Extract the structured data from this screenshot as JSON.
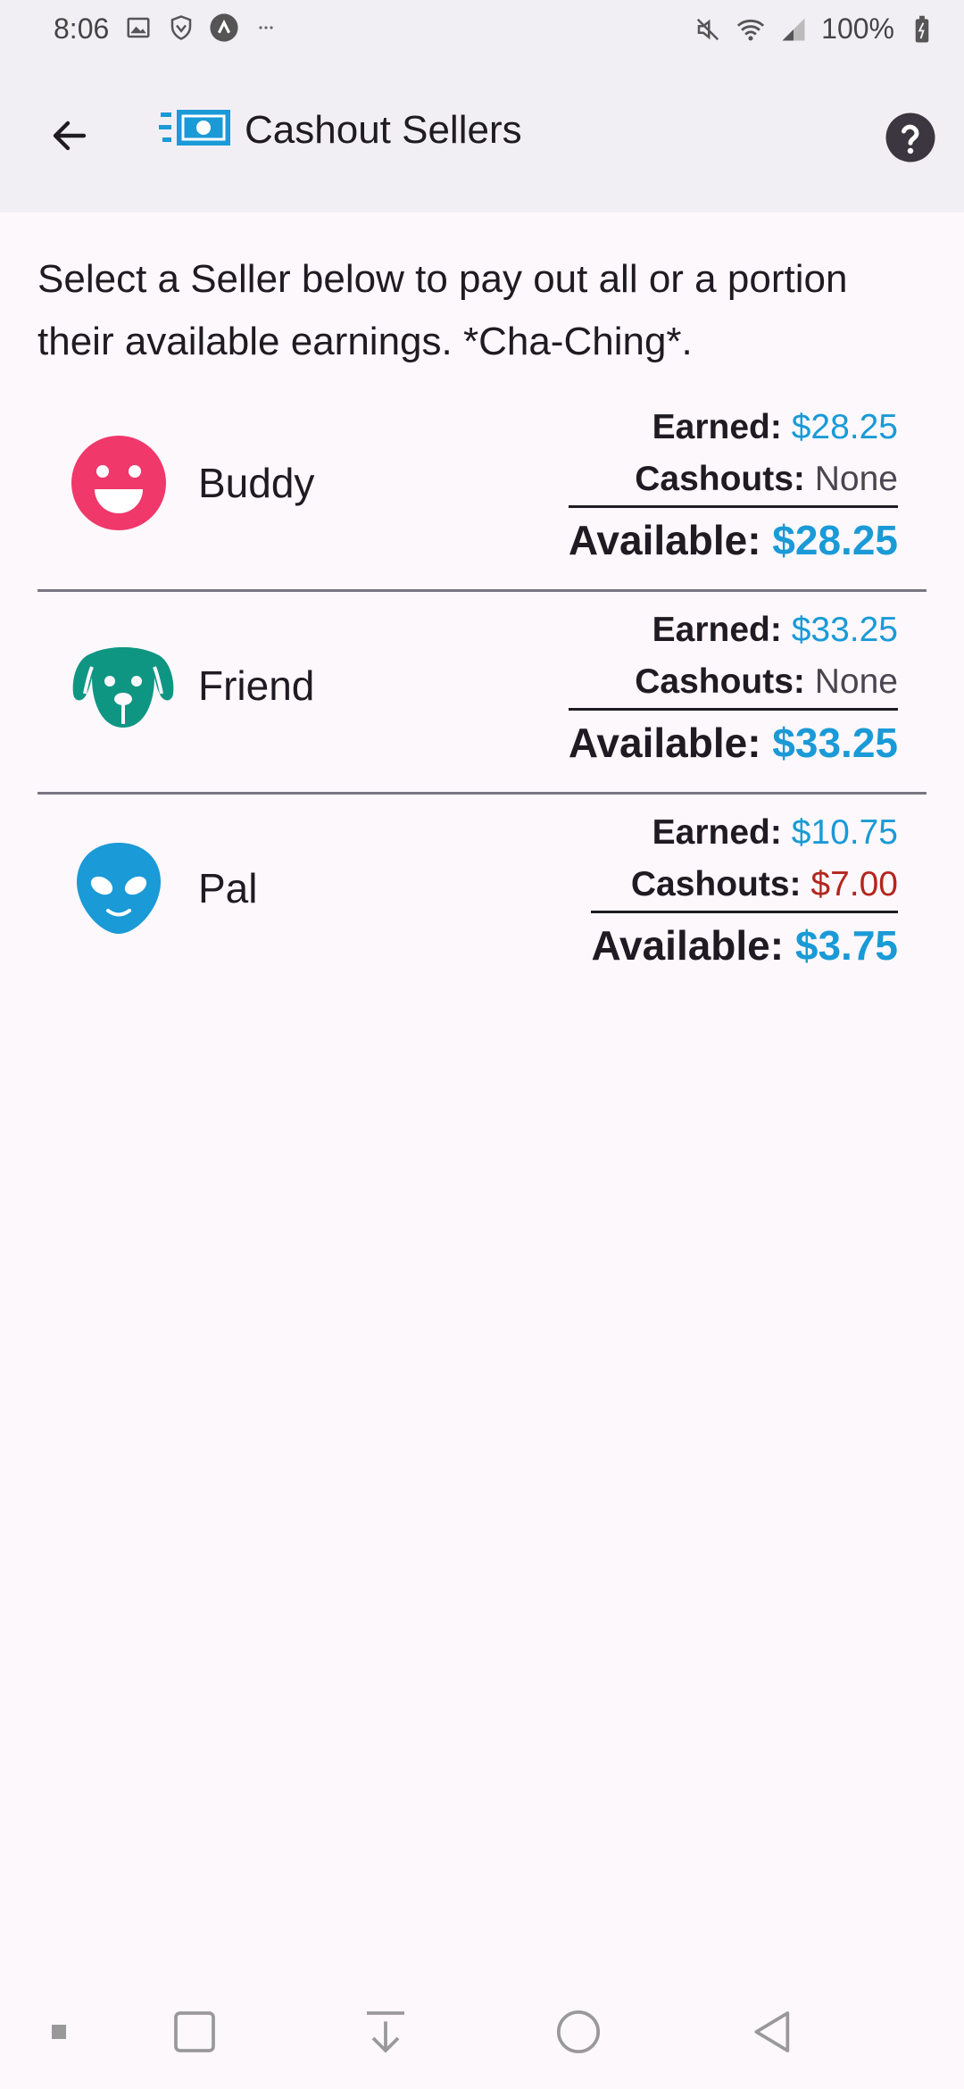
{
  "status_bar": {
    "time": "8:06",
    "battery": "100%"
  },
  "app_bar": {
    "title": "Cashout Sellers",
    "back_icon": "arrow-left-icon",
    "title_icon": "cash-fast-icon",
    "help_icon": "help-circle-icon"
  },
  "intro": {
    "text": "Select a Seller below to pay out all or a portion their available earnings. *Cha-Ching*."
  },
  "labels": {
    "earned": "Earned:",
    "cashouts": "Cashouts:",
    "available": "Available:"
  },
  "sellers": [
    {
      "name": "Buddy",
      "avatar": "smiley-face-icon",
      "avatar_color": "#f0386b",
      "earned": "$28.25",
      "cashouts": "None",
      "available": "$28.25"
    },
    {
      "name": "Friend",
      "avatar": "dog-face-icon",
      "avatar_color": "#0f9683",
      "earned": "$33.25",
      "cashouts": "None",
      "available": "$33.25"
    },
    {
      "name": "Pal",
      "avatar": "alien-face-icon",
      "avatar_color": "#1a9ad6",
      "earned": "$10.75",
      "cashouts": "$7.00",
      "available": "$3.75"
    }
  ],
  "colors": {
    "accent": "#1a9ad6",
    "cashout_negative": "#b3261e"
  },
  "nav_bar": [
    "dot-icon",
    "recents-square-icon",
    "download-arrow-icon",
    "home-circle-icon",
    "back-triangle-icon"
  ]
}
